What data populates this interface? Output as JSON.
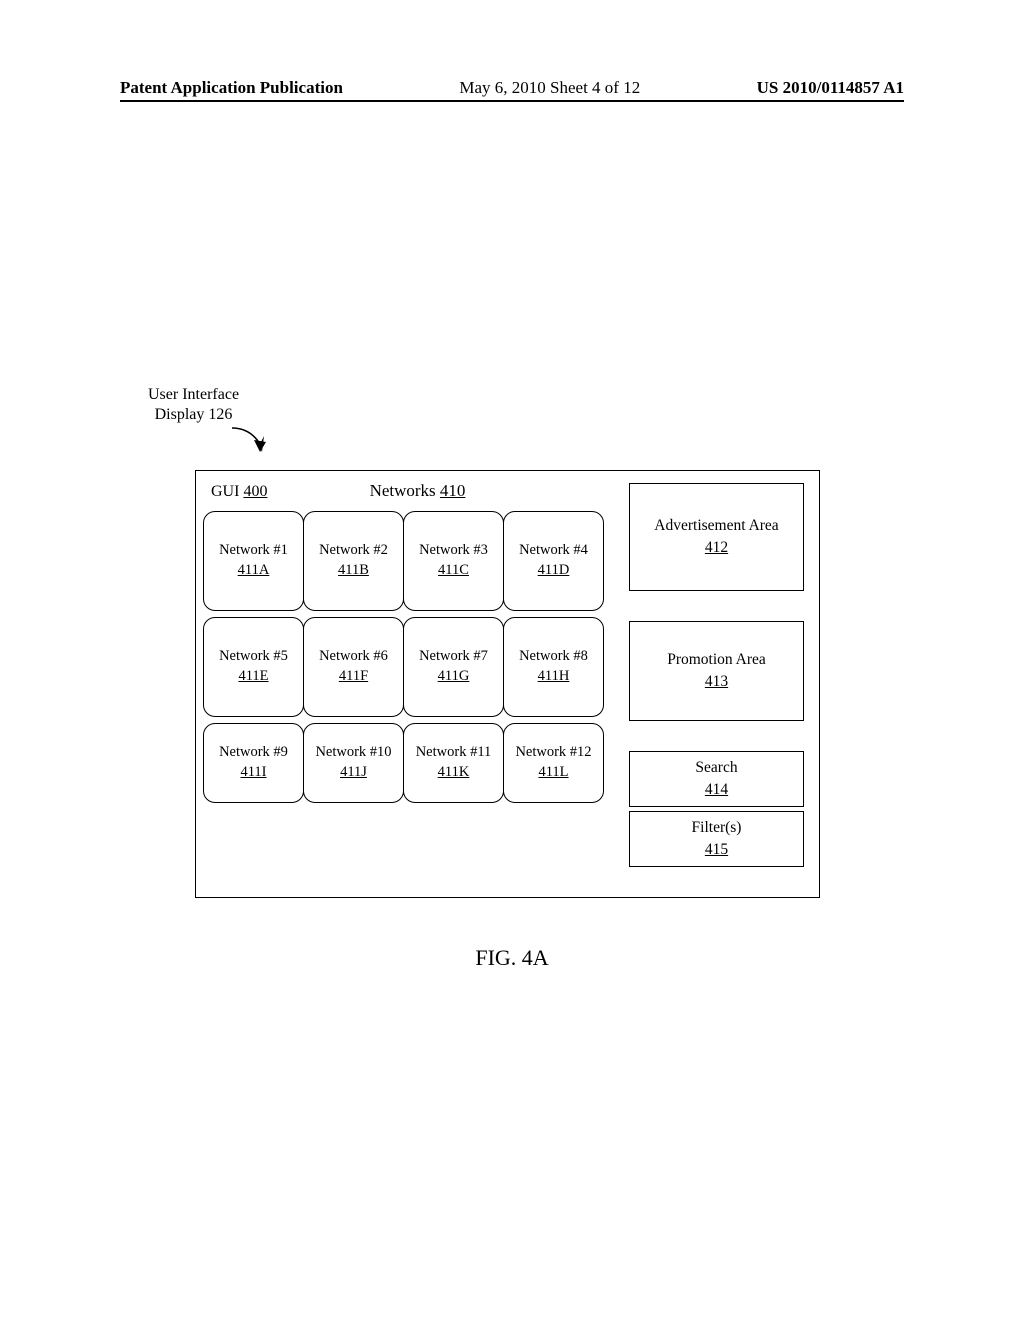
{
  "header": {
    "left": "Patent Application Publication",
    "center": "May 6, 2010  Sheet 4 of 12",
    "right": "US 2010/0114857 A1"
  },
  "callout": {
    "line1": "User Interface",
    "line2_pre": "Display ",
    "line2_num": "126"
  },
  "gui": {
    "label_pre": "GUI ",
    "label_ref": "400"
  },
  "networks_header": {
    "label_pre": "Networks ",
    "label_ref": "410"
  },
  "cells": [
    {
      "title": "Network #1",
      "ref": "411A"
    },
    {
      "title": "Network #2",
      "ref": "411B"
    },
    {
      "title": "Network #3",
      "ref": "411C"
    },
    {
      "title": "Network #4",
      "ref": "411D"
    },
    {
      "title": "Network #5",
      "ref": "411E"
    },
    {
      "title": "Network #6",
      "ref": "411F"
    },
    {
      "title": "Network #7",
      "ref": "411G"
    },
    {
      "title": "Network #8",
      "ref": "411H"
    },
    {
      "title": "Network #9",
      "ref": "411I"
    },
    {
      "title": "Network #10",
      "ref": "411J"
    },
    {
      "title": "Network #11",
      "ref": "411K"
    },
    {
      "title": "Network #12",
      "ref": "411L"
    }
  ],
  "side": {
    "ad": {
      "title": "Advertisement Area",
      "ref": "412"
    },
    "promo": {
      "title": "Promotion Area",
      "ref": "413"
    },
    "search": {
      "title": "Search",
      "ref": "414"
    },
    "filters": {
      "title": "Filter(s)",
      "ref": "415"
    }
  },
  "figure_caption": "FIG. 4A"
}
